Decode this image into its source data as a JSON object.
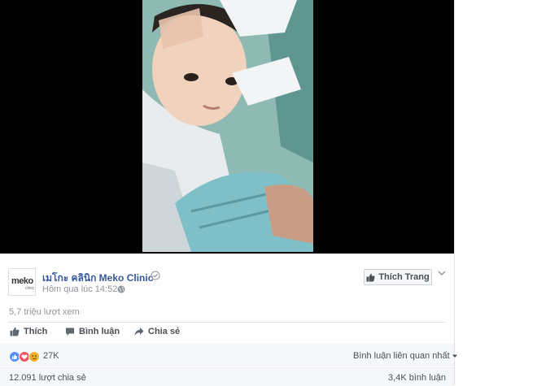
{
  "post": {
    "page_name": "เมโกะ คลินิก Meko Clinic",
    "logo_text": "meko",
    "logo_subtext": "clinic",
    "timestamp": "Hôm qua lúc 14:52",
    "like_page_label": "Thích Trang",
    "views": "5,7 triệu lượt xem"
  },
  "actions": {
    "like": "Thích",
    "comment": "Bình luận",
    "share": "Chia sẻ"
  },
  "reactions": {
    "icons": [
      "like-icon",
      "love-icon",
      "sad-icon"
    ],
    "colors": {
      "like": "#5890ff",
      "love": "#f25268",
      "sad": "#f7b125"
    },
    "count": "27K",
    "sort_label": "Bình luận liên quan nhất"
  },
  "stats": {
    "shares": "12.091 lượt chia sẻ",
    "comments": "3,4K bình luận"
  },
  "colors": {
    "link": "#365899",
    "meta": "#90949c",
    "video_bg": "#000000"
  }
}
